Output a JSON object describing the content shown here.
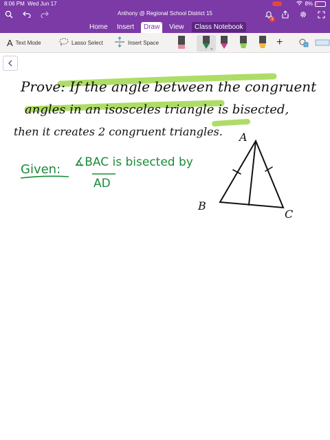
{
  "status_bar": {
    "time": "8:06 PM",
    "date": "Wed Jun 17",
    "battery": "8%"
  },
  "header": {
    "title": "Anthony @ Regional School District 15",
    "notification_count": "1"
  },
  "tabs": [
    {
      "label": "Home",
      "active": false
    },
    {
      "label": "Insert",
      "active": false
    },
    {
      "label": "Draw",
      "active": true
    },
    {
      "label": "View",
      "active": false
    },
    {
      "label": "Class Notebook",
      "active": false
    }
  ],
  "toolbar": {
    "text_mode": "Text Mode",
    "lasso_select": "Lasso Select",
    "insert_space": "Insert Space",
    "text_mode_icon": "A"
  },
  "icons": {
    "search": "search-icon",
    "undo": "undo-icon",
    "redo": "redo-icon",
    "bell": "bell-icon",
    "share": "share-icon",
    "gear": "gear-icon",
    "expand": "expand-icon",
    "add": "add-icon",
    "back": "back-chevron-icon"
  },
  "colors": {
    "accent": "#7b3aa6",
    "ink_black": "#111111",
    "ink_green": "#1a8a3a",
    "highlight": "#9bd34a"
  },
  "pens": [
    {
      "color": "#4a4a4a",
      "tip": "#e38aa0",
      "kind": "eraser"
    },
    {
      "color": "#2e7d4f",
      "tip": "#2e7d4f",
      "kind": "pen",
      "selected": true
    },
    {
      "color": "#d23c8c",
      "tip": "#d23c8c",
      "kind": "pen"
    },
    {
      "color": "#57a22b",
      "tip": "#8bd14a",
      "kind": "highlighter"
    },
    {
      "color": "#f0a020",
      "tip": "#f6b43c",
      "kind": "highlighter"
    }
  ],
  "handwriting": {
    "prove_line1": "Prove: If the angle between the congruent",
    "prove_line2": "angles in an isosceles triangle is bisected,",
    "prove_line3": "then it creates 2 congruent triangles.",
    "given_label": "Given:",
    "given_text": "∡BAC is bisected by",
    "given_segment": "AD",
    "vertex_a": "A",
    "vertex_b": "B",
    "vertex_c": "C"
  }
}
